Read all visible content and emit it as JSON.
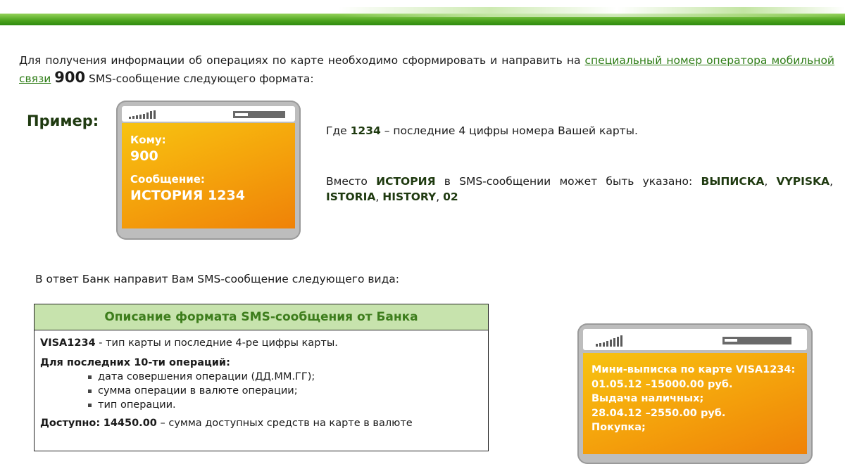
{
  "intro": {
    "text_before": "Для получения информации об операциях по карте необходимо сформировать и направить на ",
    "link": "специальный номер оператора мобильной связи",
    "number": "900",
    "text_after": " SMS-сообщение следующего формата:"
  },
  "example": {
    "label": "Пример:",
    "to_label": "Кому:",
    "to_value": "900",
    "message_label": "Сообщение:",
    "message_value": "ИСТОРИЯ 1234"
  },
  "where": {
    "prefix": "Где ",
    "code": "1234",
    "suffix": " – последние 4 цифры номера Вашей карты."
  },
  "instead": {
    "prefix": "Вместо ",
    "keyword": "ИСТОРИЯ",
    "middle": " в SMS-сообщении может быть указано: ",
    "options": [
      "ВЫПИСКА",
      "VYPISKA",
      "ISTORIA",
      "HISTORY",
      "02"
    ]
  },
  "response_intro": "В ответ Банк направит Вам SMS-сообщение следующего вида:",
  "format_table": {
    "title": "Описание формата SMS-сообщения от Банка",
    "card_code": "VISA1234",
    "card_desc": " - тип карты и последние 4-ре цифры карты.",
    "ops_title": "Для последних 10-ти операций:",
    "items": [
      "дата совершения операции (ДД.ММ.ГГ);",
      "сумма операции в валюте операции;",
      "тип операции."
    ],
    "available_label": "Доступно:",
    "available_value": "14450.00",
    "available_desc": " – сумма доступных средств на карте в валюте"
  },
  "reply_phone": {
    "lines": [
      "Мини-выписка по карте VISA1234:",
      "01.05.12 –15000.00 руб.",
      "Выдача наличных;",
      "28.04.12 –2550.00 руб.",
      "Покупка;"
    ]
  },
  "colors": {
    "accent_green": "#2e7d16",
    "table_header_bg": "#c7e3ad",
    "sms_orange": "#f5a60c"
  }
}
